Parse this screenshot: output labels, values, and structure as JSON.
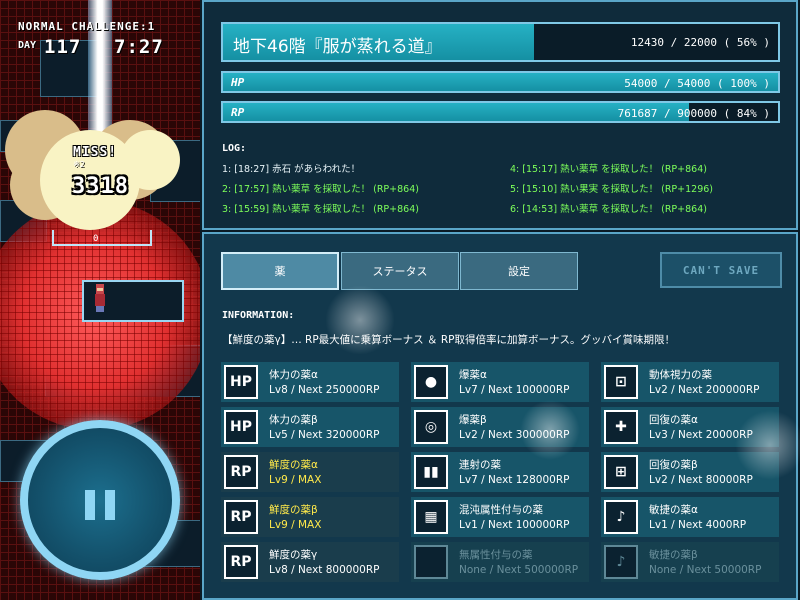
{
  "hud": {
    "challenge": "NORMAL CHALLENGE:1",
    "day_label": "DAY",
    "day": "117",
    "time": "7:27"
  },
  "battle": {
    "miss_text": "MISS!",
    "miss_sub": "※2",
    "damage": "3318",
    "enemy_count": "0"
  },
  "floor": {
    "name": "地下46階『服が蒸れる道』",
    "value": "12430 / 22000 ( 56% )",
    "progress": 0.56
  },
  "hp": {
    "label": "HP",
    "value": "54000 / 54000 ( 100% )",
    "progress": 1.0
  },
  "rp": {
    "label": "RP",
    "value": "761687 / 900000 ( 84% )",
    "progress": 0.84
  },
  "log": {
    "label": "LOG:",
    "entries": [
      {
        "text": "1: [18:27] 赤石 があらわれた！",
        "color": "white"
      },
      {
        "text": "2: [17:57] 熱い薬草 を採取した！ (RP+864)",
        "color": "green"
      },
      {
        "text": "3: [15:59] 熱い薬草 を採取した！ (RP+864)",
        "color": "green"
      },
      {
        "text": "4: [15:17] 熱い薬草 を採取した！ (RP+864)",
        "color": "green"
      },
      {
        "text": "5: [15:10] 熱い果実 を採取した！ (RP+1296)",
        "color": "green"
      },
      {
        "text": "6: [14:53] 熱い薬草 を採取した！ (RP+864)",
        "color": "green"
      }
    ]
  },
  "tabs": [
    "薬",
    "ステータス",
    "設定"
  ],
  "cant_save": "CAN'T SAVE",
  "info": {
    "label": "INFORMATION:",
    "text": "【鮮度の薬γ】… RP最大値に乗算ボーナス ＆ RP取得倍率に加算ボーナス。グッバイ賞味期限！"
  },
  "items": [
    {
      "icon": "HP",
      "name": "体力の薬α",
      "level": "Lv8 / Next 250000RP",
      "state": "normal"
    },
    {
      "icon": "HP",
      "name": "体力の薬β",
      "level": "Lv5 / Next 320000RP",
      "state": "normal"
    },
    {
      "icon": "RP",
      "name": "鮮度の薬α",
      "level": "Lv9 / MAX",
      "state": "max"
    },
    {
      "icon": "RP",
      "name": "鮮度の薬β",
      "level": "Lv9 / MAX",
      "state": "max"
    },
    {
      "icon": "RP",
      "name": "鮮度の薬γ",
      "level": "Lv8 / Next 800000RP",
      "state": "selected"
    },
    {
      "icon": "●",
      "name": "爆薬α",
      "level": "Lv7 / Next 100000RP",
      "state": "normal"
    },
    {
      "icon": "◎",
      "name": "爆薬β",
      "level": "Lv2 / Next 300000RP",
      "state": "normal"
    },
    {
      "icon": "▮▮",
      "name": "連射の薬",
      "level": "Lv7 / Next 128000RP",
      "state": "normal"
    },
    {
      "icon": "▦",
      "name": "混沌属性付与の薬",
      "level": "Lv1 / Next 100000RP",
      "state": "normal"
    },
    {
      "icon": "",
      "name": "無属性付与の薬",
      "level": "None / Next 500000RP",
      "state": "disabled"
    },
    {
      "icon": "⊡",
      "name": "動体視力の薬",
      "level": "Lv2 / Next 200000RP",
      "state": "normal"
    },
    {
      "icon": "✚",
      "name": "回復の薬α",
      "level": "Lv3 / Next 20000RP",
      "state": "normal"
    },
    {
      "icon": "⊞",
      "name": "回復の薬β",
      "level": "Lv2 / Next 80000RP",
      "state": "normal"
    },
    {
      "icon": "♪",
      "name": "敏捷の薬α",
      "level": "Lv1 / Next 4000RP",
      "state": "normal"
    },
    {
      "icon": "♪",
      "name": "敏捷の薬β",
      "level": "None / Next 50000RP",
      "state": "disabled"
    }
  ]
}
